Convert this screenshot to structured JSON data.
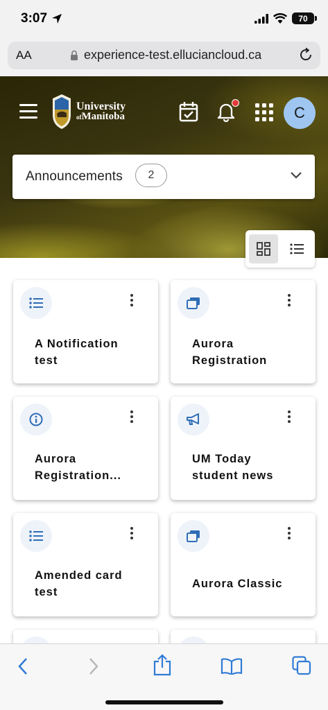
{
  "status_bar": {
    "time": "3:07",
    "battery": "70"
  },
  "browser": {
    "text_size_label": "AA",
    "url": "experience-test.elluciancloud.ca"
  },
  "header": {
    "logo_line1": "University",
    "logo_of": "of",
    "logo_line2": "Manitoba",
    "avatar_initial": "C"
  },
  "announcements": {
    "label": "Announcements",
    "count": "2"
  },
  "cards": [
    {
      "title_line1": "A Notification",
      "title_line2": "test",
      "icon": "list-icon"
    },
    {
      "title_line1": "Aurora",
      "title_line2": "Registration",
      "icon": "windows-icon"
    },
    {
      "title_line1": "Aurora",
      "title_line2": "Registration...",
      "icon": "info-icon"
    },
    {
      "title_line1": "UM Today",
      "title_line2": "student news",
      "icon": "megaphone-icon"
    },
    {
      "title_line1": "Amended card",
      "title_line2": "test",
      "icon": "list-icon"
    },
    {
      "title_line1": "Aurora Classic",
      "title_line2": "",
      "icon": "windows-icon"
    }
  ],
  "colors": {
    "accent_blue": "#2f6db5",
    "avatar_bg": "#9ec6f1",
    "notification_dot": "#e23a3a"
  }
}
